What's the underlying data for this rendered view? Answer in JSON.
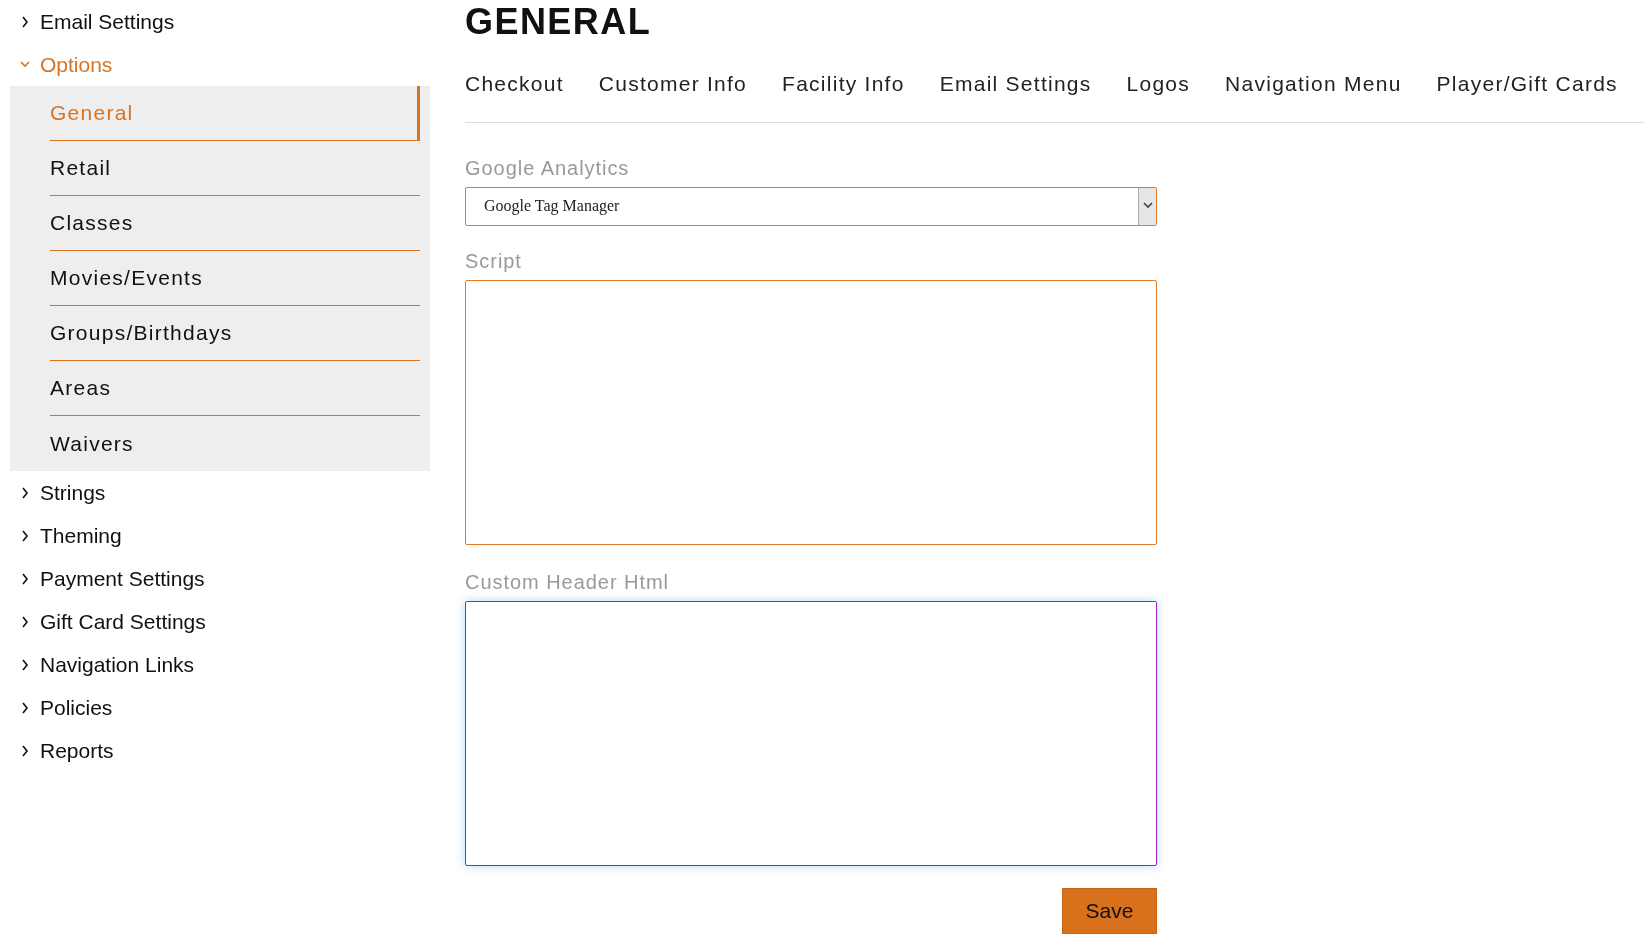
{
  "sidebar": {
    "items": [
      {
        "label": "Email Settings",
        "expanded": false
      },
      {
        "label": "Options",
        "expanded": true,
        "children": [
          {
            "label": "General",
            "selected": true
          },
          {
            "label": "Retail",
            "selected": false
          },
          {
            "label": "Classes",
            "selected": false
          },
          {
            "label": "Movies/Events",
            "selected": false
          },
          {
            "label": "Groups/Birthdays",
            "selected": false
          },
          {
            "label": "Areas",
            "selected": false
          },
          {
            "label": "Waivers",
            "selected": false
          }
        ]
      },
      {
        "label": "Strings",
        "expanded": false
      },
      {
        "label": "Theming",
        "expanded": false
      },
      {
        "label": "Payment Settings",
        "expanded": false
      },
      {
        "label": "Gift Card Settings",
        "expanded": false
      },
      {
        "label": "Navigation Links",
        "expanded": false
      },
      {
        "label": "Policies",
        "expanded": false
      },
      {
        "label": "Reports",
        "expanded": false
      }
    ]
  },
  "page": {
    "title": "GENERAL",
    "tabs": [
      {
        "label": "Checkout",
        "selected": false
      },
      {
        "label": "Customer Info",
        "selected": false
      },
      {
        "label": "Facility Info",
        "selected": false
      },
      {
        "label": "Email Settings",
        "selected": false
      },
      {
        "label": "Logos",
        "selected": false
      },
      {
        "label": "Navigation Menu",
        "selected": false
      },
      {
        "label": "Player/Gift Cards",
        "selected": false
      }
    ],
    "fields": [
      {
        "kind": "select",
        "label": "Google Analytics",
        "value": "Google Tag Manager",
        "focused": false
      },
      {
        "kind": "textarea",
        "label": "Script",
        "focused": false
      },
      {
        "kind": "textarea",
        "label": "Custom Header Html",
        "focused": true
      }
    ],
    "save_button": "Save"
  }
}
